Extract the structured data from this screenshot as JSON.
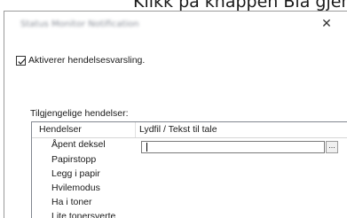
{
  "page": {
    "heading": "Klikk på knappen Bla gjennom."
  },
  "dialog": {
    "title": "Status Monitor Notification",
    "close_glyph": "✕"
  },
  "enable_checkbox": {
    "label": "Aktiverer hendelsesvarsling.",
    "checked": true
  },
  "events_section": {
    "label": "Tilgjengelige hendelser:",
    "columns": [
      "Hendelser",
      "Lydfil / Tekst til tale"
    ],
    "items": [
      {
        "label": "Åpent deksel",
        "sound_value": ""
      },
      {
        "label": "Papirstopp"
      },
      {
        "label": "Legg i papir"
      },
      {
        "label": "Hvilemodus"
      },
      {
        "label": "Ha i toner"
      },
      {
        "label": "Lite tonersverte"
      }
    ],
    "browse_label": "..."
  },
  "icons": {
    "checkbox": "checkmark-icon",
    "close": "close-icon"
  }
}
